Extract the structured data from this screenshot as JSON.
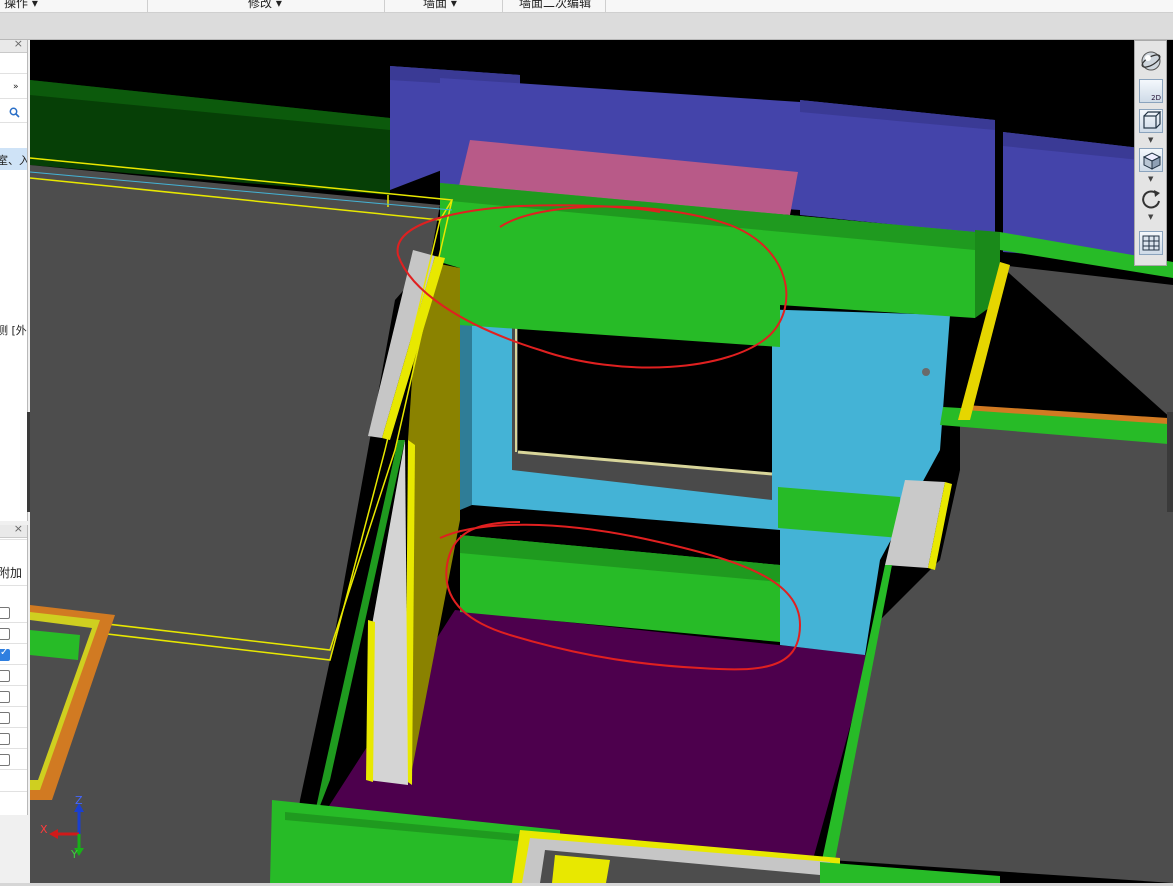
{
  "ribbon": {
    "tabs": [
      {
        "label": "操作 ▾"
      },
      {
        "label": "修改 ▾"
      },
      {
        "label": "墙面 ▾"
      },
      {
        "label": "墙面二次编辑"
      }
    ]
  },
  "left_panel_top": {
    "close_icon": "×",
    "expand_icon": "»",
    "search_icon": "search-icon",
    "row1_text": "室、入",
    "row2_text": "测 [外"
  },
  "left_panel_bottom": {
    "close_icon": "×",
    "header_text": "附加",
    "checkboxes": [
      false,
      false,
      true,
      false,
      false,
      false,
      false,
      false
    ]
  },
  "axis": {
    "z": "Z",
    "x": "X",
    "y": "Y"
  },
  "view_tools": [
    {
      "name": "orbit-sphere-icon",
      "label": ""
    },
    {
      "name": "2d-view-icon",
      "label": "2D"
    },
    {
      "name": "top-view-cube-icon",
      "label": ""
    },
    {
      "name": "iso-view-cube-icon",
      "label": ""
    },
    {
      "name": "rotate-icon",
      "label": ""
    },
    {
      "name": "view-grid-icon",
      "label": ""
    }
  ],
  "colors": {
    "floor_gray": "#4d4d4d",
    "green": "#27bb27",
    "purple_wall": "#4444aa",
    "pink": "#b85a88",
    "cyan": "#44b3d6",
    "floor_purple": "#4d004d",
    "yellow": "#e8e800",
    "annotation_red": "#e02020"
  }
}
